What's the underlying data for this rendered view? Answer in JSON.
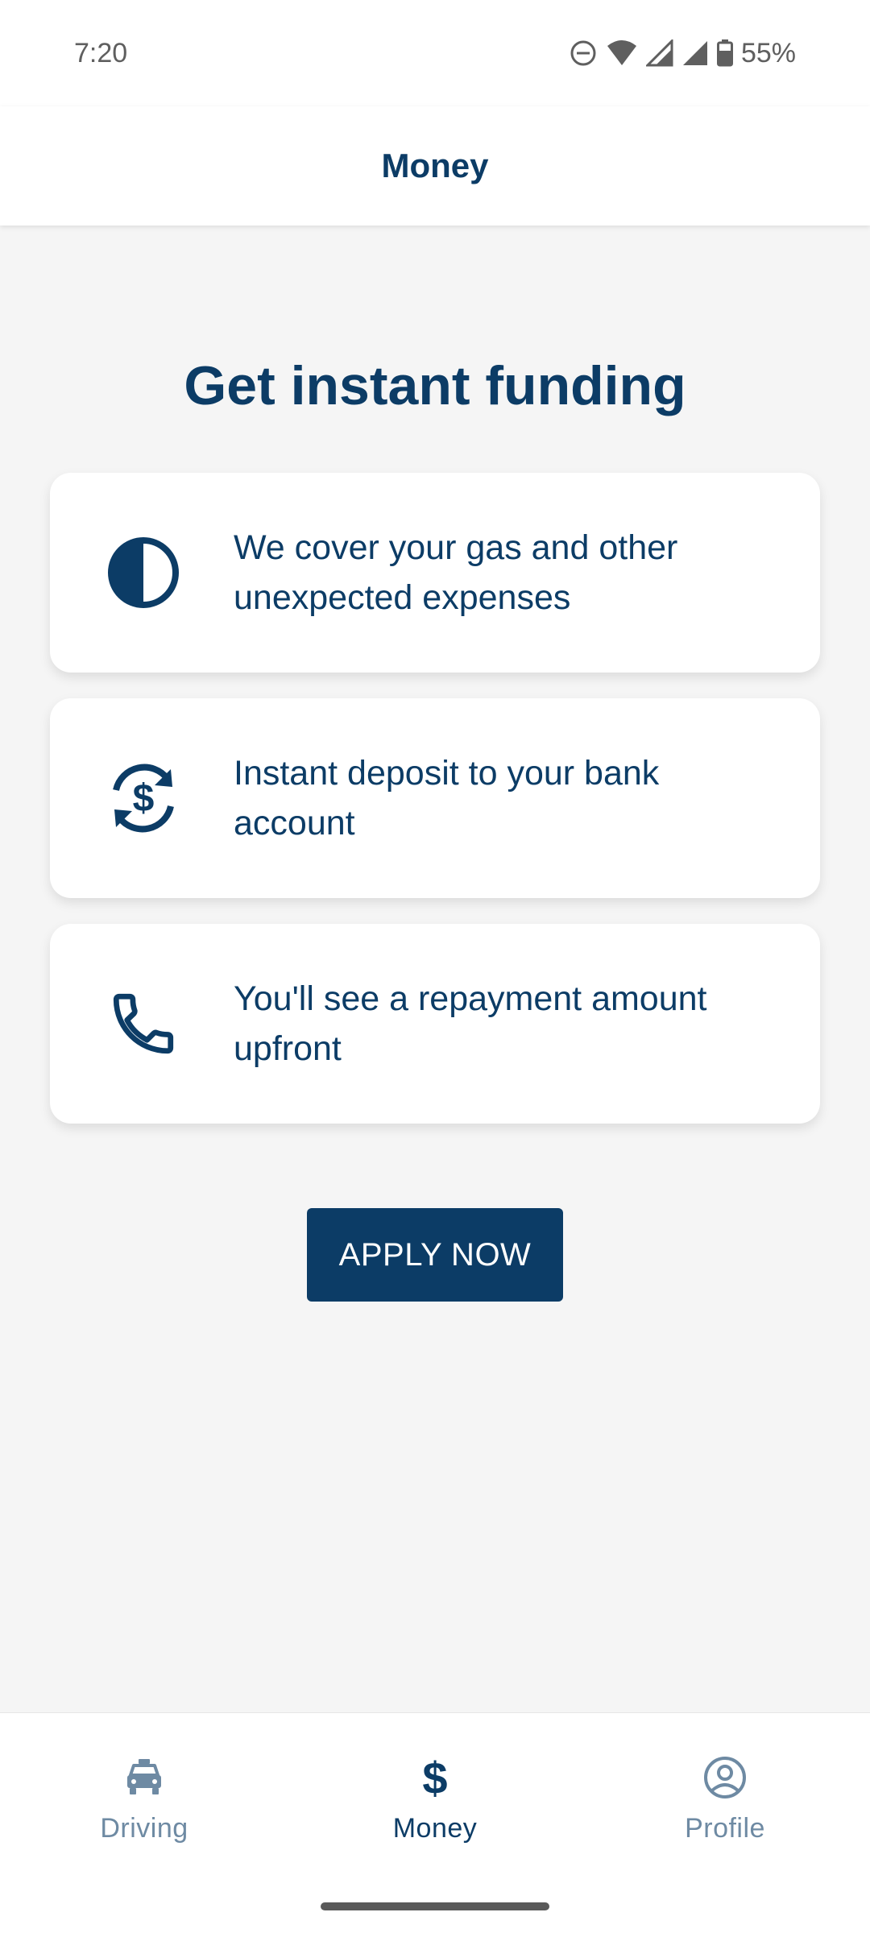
{
  "status_bar": {
    "time": "7:20",
    "battery": "55%",
    "icons": [
      "do-not-disturb-icon",
      "wifi-icon",
      "signal-icon",
      "signal-icon",
      "battery-icon"
    ]
  },
  "app_bar": {
    "title": "Money"
  },
  "main": {
    "headline": "Get instant funding",
    "cards": [
      {
        "icon": "half-circle-icon",
        "text": "We cover your gas and other unexpected expenses"
      },
      {
        "icon": "dollar-refresh-icon",
        "text": "Instant deposit to your bank account"
      },
      {
        "icon": "phone-icon",
        "text": "You'll see a repayment amount upfront"
      }
    ],
    "apply_button": "APPLY NOW"
  },
  "bottom_nav": {
    "items": [
      {
        "label": "Driving",
        "icon": "taxi-icon",
        "active": false
      },
      {
        "label": "Money",
        "icon": "dollar-icon",
        "active": true
      },
      {
        "label": "Profile",
        "icon": "profile-icon",
        "active": false
      }
    ]
  },
  "colors": {
    "primary": "#0c3c66",
    "inactive": "#6e8aa3",
    "background": "#f5f5f5",
    "card": "#ffffff"
  }
}
